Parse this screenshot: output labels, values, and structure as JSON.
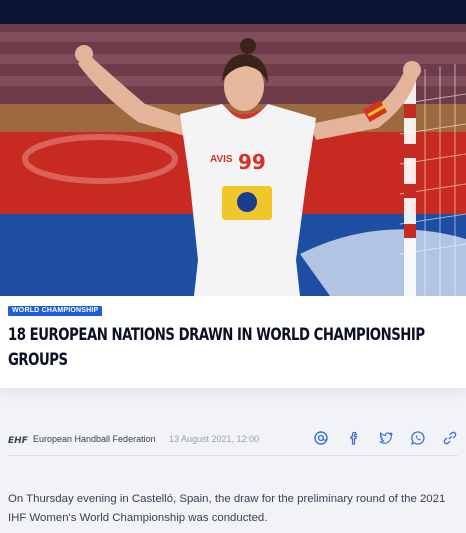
{
  "article": {
    "category": "WORLD CHAMPIONSHIP",
    "title": "18 EUROPEAN NATIONS DRAWN IN WORLD CHAMPIONSHIP GROUPS",
    "author": "European Handball Federation",
    "date": "13 August 2021, 12:00",
    "body": "On Thursday evening in Castelló, Spain, the draw for the preliminary round of the 2021 IHF Women's World Championship was conducted."
  },
  "hero": {
    "jersey_number": "99",
    "sponsor": "AVIS"
  },
  "logo": {
    "text": "EHF"
  },
  "share": {
    "icons": [
      "email-icon",
      "facebook-icon",
      "twitter-icon",
      "whatsapp-icon",
      "link-icon"
    ]
  },
  "colors": {
    "topbar": "#0b1533",
    "tag": "#1f5cd6",
    "share_icon": "#3b6fd8"
  }
}
